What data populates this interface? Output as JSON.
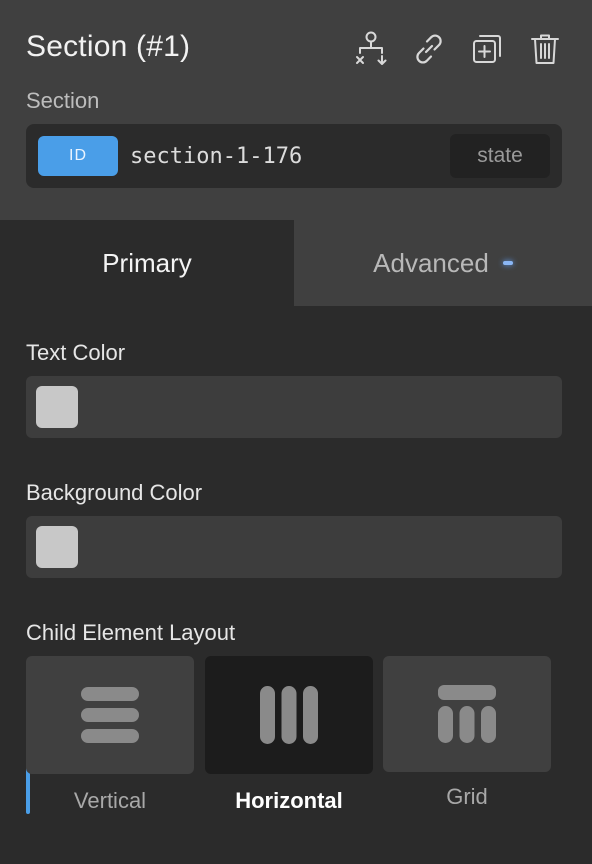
{
  "header": {
    "title": "Section (#1)",
    "subtitle": "Section"
  },
  "toolbar": {
    "icons": [
      "structure-icon",
      "link-icon",
      "duplicate-icon",
      "trash-icon"
    ]
  },
  "selector": {
    "badge": "ID",
    "value": "section-1-176",
    "state_label": "state"
  },
  "tabs": {
    "primary": "Primary",
    "advanced": "Advanced"
  },
  "fields": {
    "text_color_label": "Text Color",
    "background_color_label": "Background Color",
    "child_layout_label": "Child Element Layout"
  },
  "layout_options": {
    "vertical": "Vertical",
    "horizontal": "Horizontal",
    "grid": "Grid",
    "selected": "horizontal"
  },
  "colors": {
    "accent": "#4a9ee8",
    "panel": "#2b2b2b",
    "header": "#404040",
    "swatch": "#c8c8c8"
  }
}
